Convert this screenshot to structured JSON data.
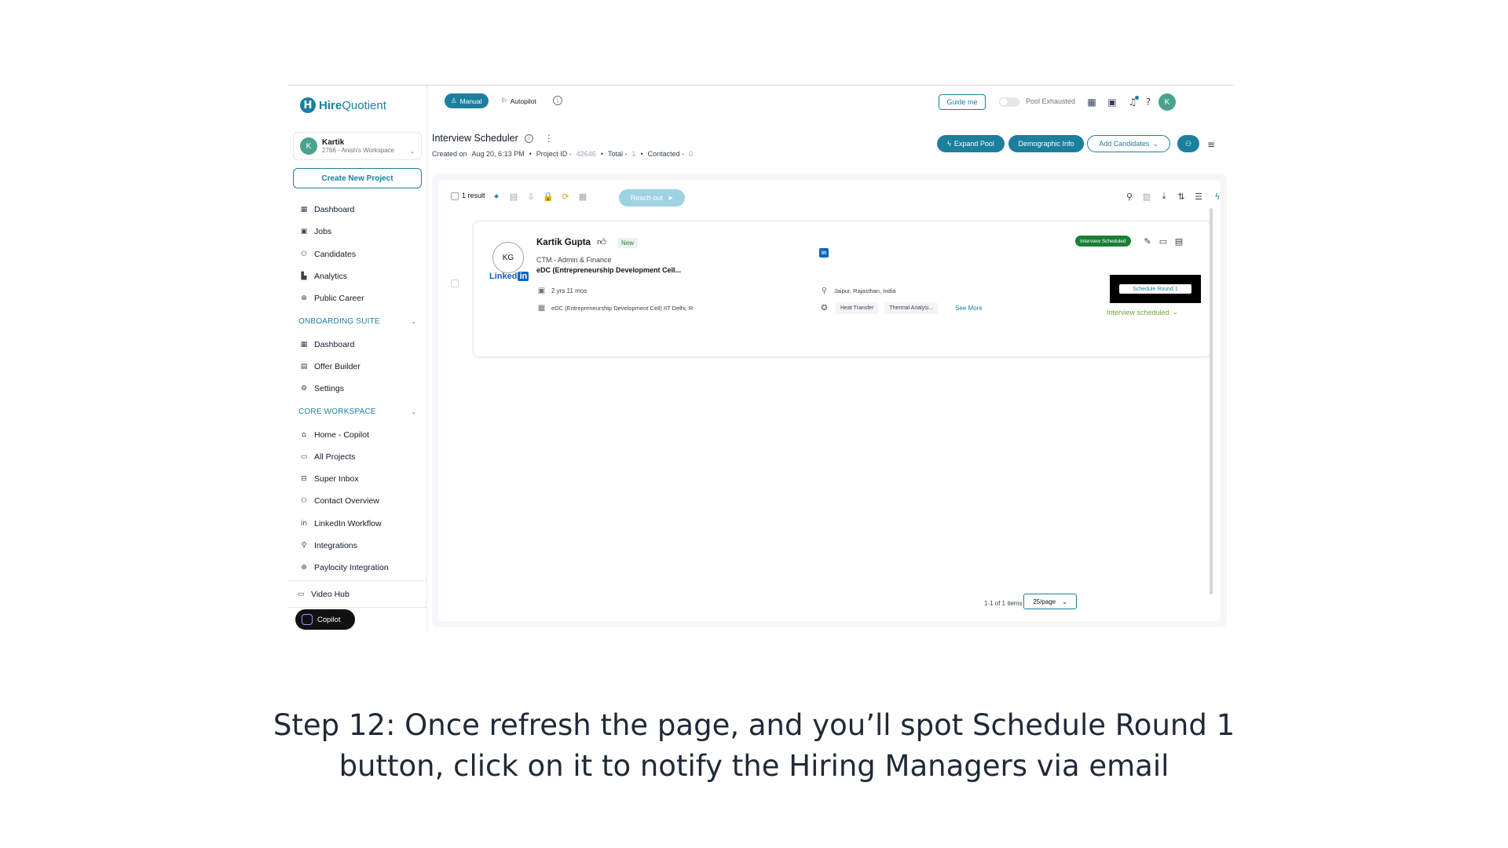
{
  "sidebar": {
    "logo": {
      "mark": "H",
      "bold": "Hire",
      "rest": "Quotient"
    },
    "workspace": {
      "avatar": "K",
      "name": "Kartik",
      "sub": "2766 - Anish's Workspace"
    },
    "create_label": "Create New Project",
    "items_main": [
      {
        "icon": "dashboard-icon",
        "glyph": "▦",
        "label": "Dashboard"
      },
      {
        "icon": "briefcase-icon",
        "glyph": "▣",
        "label": "Jobs"
      },
      {
        "icon": "users-icon",
        "glyph": "⚇",
        "label": "Candidates"
      },
      {
        "icon": "analytics-icon",
        "glyph": "▙",
        "label": "Analytics"
      },
      {
        "icon": "globe-icon",
        "glyph": "⊕",
        "label": "Public Career"
      }
    ],
    "section_onboarding": "ONBOARDING SUITE",
    "items_onboarding": [
      {
        "icon": "dashboard-icon",
        "glyph": "▦",
        "label": "Dashboard"
      },
      {
        "icon": "document-icon",
        "glyph": "▤",
        "label": "Offer Builder"
      },
      {
        "icon": "settings-icon",
        "glyph": "⚙",
        "label": "Settings"
      }
    ],
    "section_core": "CORE WORKSPACE",
    "items_core": [
      {
        "icon": "home-icon",
        "glyph": "⌂",
        "label": "Home - Copilot"
      },
      {
        "icon": "folder-icon",
        "glyph": "▭",
        "label": "All Projects"
      },
      {
        "icon": "inbox-icon",
        "glyph": "⊟",
        "label": "Super Inbox"
      },
      {
        "icon": "contacts-icon",
        "glyph": "⚇",
        "label": "Contact Overview"
      },
      {
        "icon": "linkedin-workflow-icon",
        "glyph": "in",
        "label": "LinkedIn Workflow"
      },
      {
        "icon": "integrations-icon",
        "glyph": "⚲",
        "label": "Integrations"
      },
      {
        "icon": "globe-icon",
        "glyph": "⊕",
        "label": "Paylocity Integration"
      }
    ],
    "video_hub": "Video Hub",
    "copilot": "Copilot"
  },
  "topbar": {
    "manual": "Manual",
    "autopilot": "Autopilot",
    "guide": "Guide me",
    "pool_exhausted": "Pool Exhausted",
    "user_avatar": "K"
  },
  "project": {
    "title": "Interview Scheduler",
    "created_label": "Created on",
    "created_value": "Aug 20, 6:13 PM",
    "project_id_label": "Project ID -",
    "project_id_value": "42646",
    "total_label": "Total -",
    "total_value": "1",
    "contacted_label": "Contacted -",
    "contacted_value": "0",
    "expand_pool": "Expand Pool",
    "demographic": "Demographic Info",
    "add_candidates": "Add Candidates"
  },
  "toolbar": {
    "result": "1 result",
    "reach_out": "Reach out"
  },
  "candidate": {
    "initials": "KG",
    "linkedin_word": "Linked",
    "linkedin_in": "in",
    "name": "Kartik Gupta",
    "badge": "New",
    "title": "CTM - Admin & Finance",
    "org": "eDC (Entrepreneurship Development Cell...",
    "experience": "2 yrs 11 mos",
    "education": "eDC (Entrepreneurship Development Cell) IIT Delhi, R",
    "location": "Jaipur, Rajasthan, India",
    "skills": [
      "Heat Transfer",
      "Thermal Analysi..."
    ],
    "see_more": "See More",
    "status_pill": "Interview Scheduled",
    "schedule_button": "Schedule Round 1",
    "stage": "Interview scheduled"
  },
  "pager": {
    "range": "1-1 of 1 items",
    "per_page": "25/page"
  },
  "caption": {
    "line1": "Step 12: Once refresh the page, and you’ll spot Schedule Round 1",
    "line2": "button, click on it to notify the Hiring Managers via email"
  },
  "colors": {
    "brand": "#1b7f9e",
    "success": "#1a7f37",
    "linkedin": "#0a66c2"
  }
}
